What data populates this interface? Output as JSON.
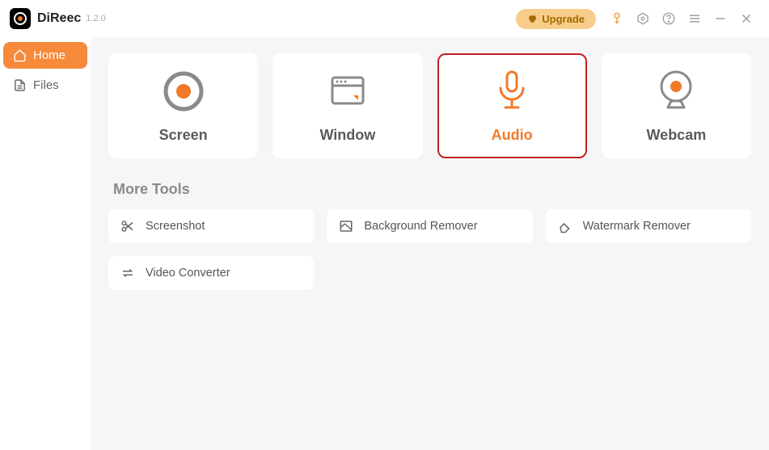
{
  "app": {
    "name": "DiReec",
    "version": "1.2.0"
  },
  "titlebar": {
    "upgrade": "Upgrade"
  },
  "sidebar": {
    "items": [
      {
        "label": "Home",
        "active": true
      },
      {
        "label": "Files",
        "active": false
      }
    ]
  },
  "cards": [
    {
      "label": "Screen"
    },
    {
      "label": "Window"
    },
    {
      "label": "Audio",
      "selected": true
    },
    {
      "label": "Webcam"
    }
  ],
  "more_tools": {
    "title": "More Tools",
    "items": [
      {
        "label": "Screenshot"
      },
      {
        "label": "Background Remover"
      },
      {
        "label": "Watermark Remover"
      },
      {
        "label": "Video Converter"
      }
    ]
  },
  "colors": {
    "accent": "#f07a2a",
    "selected_border": "#c62020",
    "upgrade_bg": "#f8cc8a"
  }
}
